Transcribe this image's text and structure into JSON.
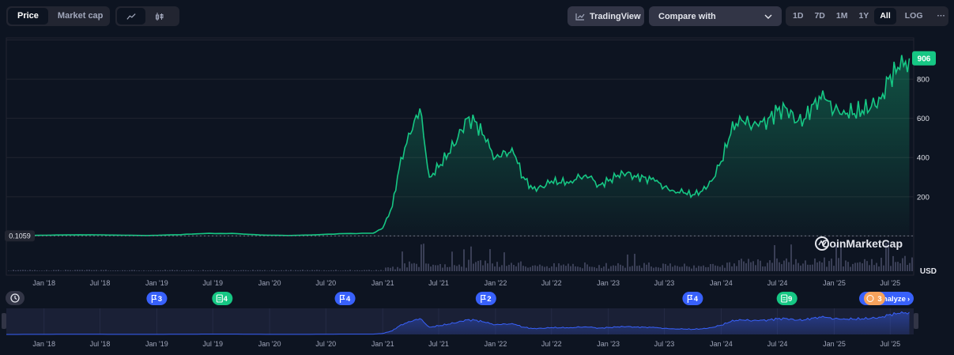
{
  "toolbar": {
    "price_label": "Price",
    "market_cap_label": "Market cap",
    "line_icon": "line-chart-icon",
    "candle_icon": "candlestick-icon",
    "tradingview_label": "TradingView",
    "tradingview_icon": "tradingview-chart-icon",
    "compare_label": "Compare with",
    "compare_icon": "chevron-down-icon",
    "ranges": [
      "1D",
      "7D",
      "1M",
      "1Y",
      "All"
    ],
    "active_range": "All",
    "log_label": "LOG",
    "more_label": "···"
  },
  "colors": {
    "background": "#0d1421",
    "line": "#16c784",
    "badge": "#16c784",
    "volume": "#3a3f56",
    "navigator": "#3861fb",
    "marker_blue": "#3861fb",
    "marker_green": "#16c784",
    "marker_orange": "#f7a35c"
  },
  "chart_data": {
    "type": "area",
    "x": [
      "2017-09",
      "2017-12",
      "2018-03",
      "2018-06",
      "2018-09",
      "2018-12",
      "2019-03",
      "2019-06",
      "2019-09",
      "2019-12",
      "2020-03",
      "2020-06",
      "2020-09",
      "2020-12",
      "2021-01",
      "2021-02",
      "2021-03",
      "2021-04",
      "2021-05",
      "2021-06",
      "2021-07",
      "2021-08",
      "2021-09",
      "2021-10",
      "2021-11",
      "2021-12",
      "2022-01",
      "2022-02",
      "2022-03",
      "2022-04",
      "2022-05",
      "2022-06",
      "2022-07",
      "2022-08",
      "2022-09",
      "2022-10",
      "2022-11",
      "2022-12",
      "2023-01",
      "2023-02",
      "2023-03",
      "2023-04",
      "2023-05",
      "2023-06",
      "2023-07",
      "2023-08",
      "2023-09",
      "2023-10",
      "2023-11",
      "2023-12",
      "2024-01",
      "2024-02",
      "2024-03",
      "2024-04",
      "2024-05",
      "2024-06",
      "2024-07",
      "2024-08",
      "2024-09",
      "2024-10",
      "2024-11",
      "2024-12",
      "2025-01",
      "2025-02",
      "2025-03",
      "2025-04",
      "2025-05",
      "2025-06",
      "2025-07",
      "2025-08",
      "2025-09"
    ],
    "y": [
      0.1059,
      3,
      5,
      6,
      4,
      2,
      6,
      12,
      13,
      5,
      2,
      6,
      12,
      14,
      40,
      150,
      400,
      520,
      650,
      300,
      350,
      420,
      500,
      600,
      580,
      480,
      400,
      430,
      420,
      300,
      240,
      250,
      280,
      270,
      280,
      300,
      300,
      260,
      280,
      310,
      320,
      300,
      300,
      280,
      250,
      230,
      220,
      210,
      230,
      280,
      380,
      520,
      610,
      570,
      560,
      600,
      640,
      650,
      580,
      600,
      700,
      700,
      640,
      640,
      620,
      640,
      660,
      700,
      820,
      850,
      906
    ],
    "current_value": 906,
    "start_value": 0.1059,
    "y_ticks": [
      200,
      400,
      600,
      800
    ],
    "y_labels": [
      "200",
      "400",
      "600",
      "800"
    ],
    "x_labels": [
      "Jan '18",
      "Jul '18",
      "Jan '19",
      "Jul '19",
      "Jan '20",
      "Jul '20",
      "Jan '21",
      "Jul '21",
      "Jan '22",
      "Jul '22",
      "Jan '23",
      "Jul '23",
      "Jan '24",
      "Jul '24",
      "Jan '25",
      "Jul '25"
    ],
    "x_label_dates": [
      "2018-01",
      "2018-07",
      "2019-01",
      "2019-07",
      "2020-01",
      "2020-07",
      "2021-01",
      "2021-07",
      "2022-01",
      "2022-07",
      "2023-01",
      "2023-07",
      "2024-01",
      "2024-07",
      "2025-01",
      "2025-07"
    ],
    "ylim": [
      -200,
      1010
    ],
    "currency": "USD",
    "watermark": "CoinMarketCap",
    "markers": [
      {
        "type": "flag",
        "count": "3",
        "date": "2019-01"
      },
      {
        "type": "doc",
        "count": "4",
        "date": "2019-08"
      },
      {
        "type": "flag",
        "count": "4",
        "date": "2020-09"
      },
      {
        "type": "flag",
        "count": "2",
        "date": "2021-12"
      },
      {
        "type": "flag",
        "count": "4",
        "date": "2023-10"
      },
      {
        "type": "doc",
        "count": "9",
        "date": "2024-08"
      }
    ],
    "analyze_label": "Analyze",
    "analyze_count": "3",
    "history_icon": "history-clock-icon"
  }
}
